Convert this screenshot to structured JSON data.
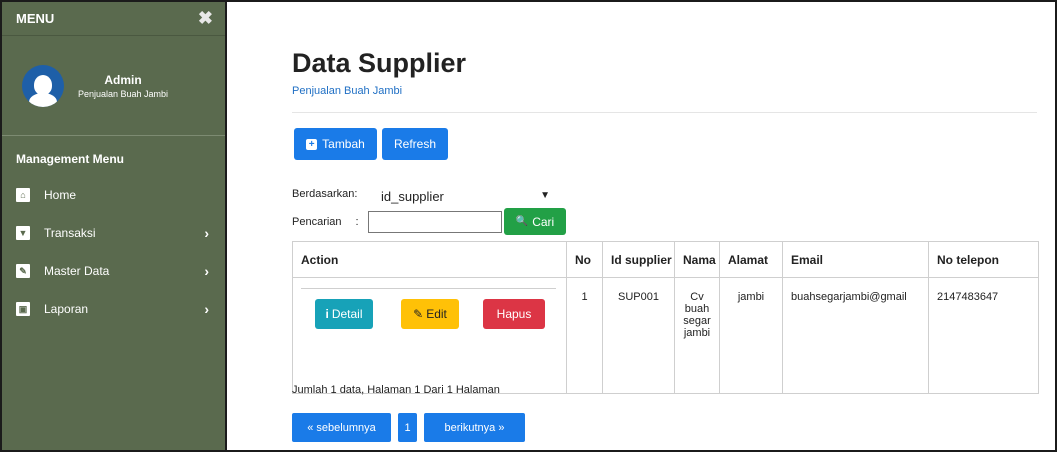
{
  "sidebar": {
    "menu_label": "MENU",
    "close_glyph": "✖",
    "user_name": "Admin",
    "user_sub": "Penjualan Buah Jambi",
    "section_label": "Management Menu",
    "items": [
      {
        "label": "Home",
        "icon": "home-icon",
        "glyph": "⌂",
        "has_arrow": false
      },
      {
        "label": "Transaksi",
        "icon": "cart-icon",
        "glyph": "▼",
        "has_arrow": true
      },
      {
        "label": "Master Data",
        "icon": "edit-icon",
        "glyph": "✎",
        "has_arrow": true
      },
      {
        "label": "Laporan",
        "icon": "calendar-icon",
        "glyph": "▣",
        "has_arrow": true
      }
    ],
    "arrow": "›"
  },
  "main": {
    "title": "Data Supplier",
    "subtitle": "Penjualan Buah Jambi",
    "add_label": "Tambah",
    "add_glyph": "+",
    "refresh_label": "Refresh",
    "filter_label": "Berdasarkan",
    "filter_value": "id_supplier",
    "search_label": "Pencarian",
    "search_value": "",
    "search_button": "Cari",
    "search_glyph": "🔍",
    "colon": ":"
  },
  "table": {
    "headers": [
      "Action",
      "No",
      "Id supplier",
      "Nama",
      "Alamat",
      "Email",
      "No telepon"
    ],
    "rows": [
      {
        "no": "1",
        "id": "SUP001",
        "nama": "Cv buah segar jambi",
        "alamat": "jambi",
        "email": "buahsegarjambi@gmail",
        "telepon": "2147483647"
      }
    ],
    "action_buttons": {
      "detail": "Detail",
      "edit": "Edit",
      "hapus": "Hapus"
    },
    "detail_glyph": "i",
    "edit_glyph": "✎"
  },
  "footer": {
    "summary": "Jumlah 1 data, Halaman 1 Dari 1 Halaman",
    "prev": "« sebelumnya",
    "page": "1",
    "next": "berikutnya »"
  },
  "colors": {
    "sidebar_bg": "#5a6a4e",
    "primary": "#1a7be8",
    "success": "#22a046",
    "info": "#17a2b8",
    "warning": "#ffc107",
    "danger": "#dc3545"
  }
}
